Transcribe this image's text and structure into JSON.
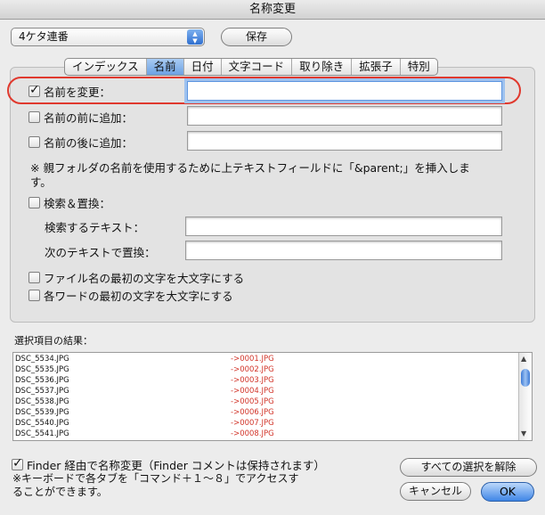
{
  "window": {
    "title": "名称変更"
  },
  "preset": {
    "value": "4ケタ連番"
  },
  "save_button": "保存",
  "tabs": [
    {
      "label": "インデックス",
      "selected": false
    },
    {
      "label": "名前",
      "selected": true
    },
    {
      "label": "日付",
      "selected": false
    },
    {
      "label": "文字コード",
      "selected": false
    },
    {
      "label": "取り除き",
      "selected": false
    },
    {
      "label": "拡張子",
      "selected": false
    },
    {
      "label": "特別",
      "selected": false
    }
  ],
  "name_tab": {
    "change_name": {
      "label": "名前を変更：",
      "checked": true,
      "value": ""
    },
    "prepend": {
      "label": "名前の前に追加：",
      "checked": false,
      "value": ""
    },
    "append": {
      "label": "名前の後に追加：",
      "checked": false,
      "value": ""
    },
    "note": "※ 親フォルダの名前を使用するために上テキストフィールドに「&parent;」を挿入しま\nす。",
    "search_replace": {
      "label": "検索＆置換：",
      "checked": false
    },
    "search_text": {
      "label": "検索するテキスト：",
      "value": ""
    },
    "replace_text": {
      "label": "次のテキストで置換：",
      "value": ""
    },
    "capitalize_file": {
      "label": "ファイル名の最初の文字を大文字にする",
      "checked": false
    },
    "capitalize_word": {
      "label": "各ワードの最初の文字を大文字にする",
      "checked": false
    }
  },
  "results": {
    "label": "選択項目の結果：",
    "rows": [
      {
        "old": "DSC_5534.JPG",
        "new": "->0001.JPG"
      },
      {
        "old": "DSC_5535.JPG",
        "new": "->0002.JPG"
      },
      {
        "old": "DSC_5536.JPG",
        "new": "->0003.JPG"
      },
      {
        "old": "DSC_5537.JPG",
        "new": "->0004.JPG"
      },
      {
        "old": "DSC_5538.JPG",
        "new": "->0005.JPG"
      },
      {
        "old": "DSC_5539.JPG",
        "new": "->0006.JPG"
      },
      {
        "old": "DSC_5540.JPG",
        "new": "->0007.JPG"
      },
      {
        "old": "DSC_5541.JPG",
        "new": "->0008.JPG"
      }
    ]
  },
  "footer": {
    "finder_rename": {
      "label": "Finder 経由で名称変更（Finder コメントは保持されます）",
      "checked": true
    },
    "hint": "※キーボードで各タブを「コマンド＋１〜８」でアクセスす\nることができます。",
    "clear_all": "すべての選択を解除",
    "cancel": "キャンセル",
    "ok": "OK"
  },
  "colors": {
    "accent": "#3f86e6",
    "highlight_oval": "#e0392e",
    "new_name": "#d2352a"
  }
}
